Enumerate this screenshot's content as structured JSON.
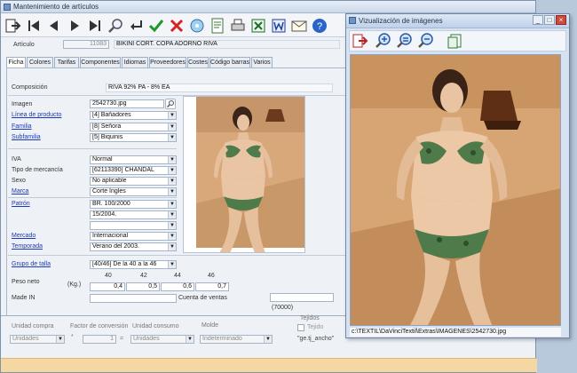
{
  "main_window": {
    "title": "Mantenimiento de artículos",
    "buttons": {
      "minimize": "_",
      "maximize": "□",
      "close": "×"
    }
  },
  "toolbar_icons": [
    "exit-icon",
    "first-record-icon",
    "previous-record-icon",
    "next-record-icon",
    "last-record-icon",
    "search-icon",
    "back-icon",
    "accept-icon",
    "cancel-icon",
    "cd-icon",
    "note-icon",
    "print-icon",
    "excel-icon",
    "word-icon",
    "mail-icon",
    "help-icon"
  ],
  "article": {
    "label": "Artículo",
    "code": "11083",
    "description": "BIKINI CORT. COPA ADORNO RIVA"
  },
  "tabs": [
    "Ficha",
    "Colores",
    "Tarifas",
    "Componentes",
    "Idiomas",
    "Proveedores",
    "Costes",
    "Código barras",
    "Varios"
  ],
  "form": {
    "composicion_label": "Composición",
    "composicion": "RIVA 92% PA - 8% EA",
    "imagen_label": "Imagen",
    "imagen": "2542730.jpg",
    "linea_label": "Línea de producto",
    "linea": "[4] Bañadores",
    "familia_label": "Familia",
    "familia": "[8] Señora",
    "subfamilia_label": "Subfamilia",
    "subfamilia": "[5] Biquinis",
    "iva_label": "IVA",
    "iva": "Normal",
    "tipo_label": "Tipo de mercancía",
    "tipo": "[62113390] CHANDAL",
    "sexo_label": "Sexo",
    "sexo": "No aplicable",
    "marca_label": "Marca",
    "marca": "Corte Ingles",
    "patron_label": "Patrón",
    "patron": "BR. 100/2000",
    "patron2": "15/2004.",
    "mercado_label": "Mercado",
    "mercado": "Internacional",
    "temporada_label": "Temporada",
    "temporada": "Verano del 2003.",
    "grupo_label": "Grupo de talla",
    "grupo": "[40/46] De la 40 a la 46",
    "sizes": [
      "40",
      "42",
      "44",
      "46"
    ],
    "peso_label": "Peso neto",
    "peso_unit": "(Kg.)",
    "pesos": [
      "0,4",
      "0,5",
      "0,6",
      "0,7"
    ],
    "made_label": "Made IN",
    "cuenta_label": "Cuenta de ventas",
    "cuenta": "(70000)",
    "unidad_compra_label": "Unidad compra",
    "unidad_compra": "Unidades",
    "factor_label": "Factor de conversión",
    "factor": "1",
    "unidad_consumo_label": "Unidad consumo",
    "unidad_consumo": "Unidades",
    "molde_label": "Molde",
    "molde": "Indeterminado",
    "tejidos_label": "Tejidos",
    "tejido_check": "Tejido",
    "ancho": "\"ge.tj_ancho\""
  },
  "viewer_window": {
    "title": "Vizualización de imágenes",
    "tools": [
      "exit-icon",
      "zoom-in-icon",
      "zoom-reset-icon",
      "zoom-out-icon",
      "copy-icon"
    ],
    "path": "c:\\TEXTIL\\DaVinciTextil\\Extras\\IMAGENES\\2542730.jpg"
  },
  "colors": {
    "accent": "#1d3bb8",
    "status_bar": "#f5d7a1",
    "bikini": "#4f7a4a"
  }
}
